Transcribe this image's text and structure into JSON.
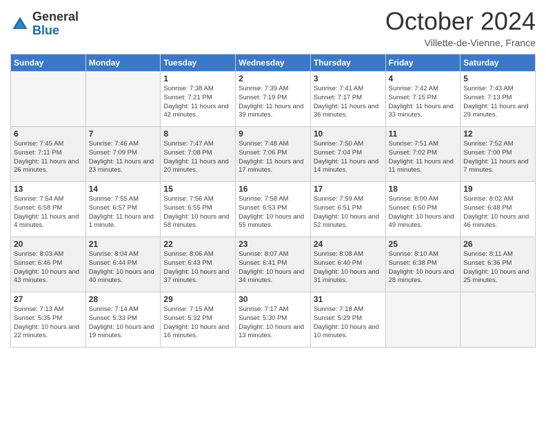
{
  "logo": {
    "general": "General",
    "blue": "Blue"
  },
  "title": "October 2024",
  "location": "Villette-de-Vienne, France",
  "days_of_week": [
    "Sunday",
    "Monday",
    "Tuesday",
    "Wednesday",
    "Thursday",
    "Friday",
    "Saturday"
  ],
  "weeks": [
    [
      {
        "day": "",
        "info": ""
      },
      {
        "day": "",
        "info": ""
      },
      {
        "day": "1",
        "info": "Sunrise: 7:38 AM\nSunset: 7:21 PM\nDaylight: 11 hours and 42 minutes."
      },
      {
        "day": "2",
        "info": "Sunrise: 7:39 AM\nSunset: 7:19 PM\nDaylight: 11 hours and 39 minutes."
      },
      {
        "day": "3",
        "info": "Sunrise: 7:41 AM\nSunset: 7:17 PM\nDaylight: 11 hours and 36 minutes."
      },
      {
        "day": "4",
        "info": "Sunrise: 7:42 AM\nSunset: 7:15 PM\nDaylight: 11 hours and 33 minutes."
      },
      {
        "day": "5",
        "info": "Sunrise: 7:43 AM\nSunset: 7:13 PM\nDaylight: 11 hours and 29 minutes."
      }
    ],
    [
      {
        "day": "6",
        "info": "Sunrise: 7:45 AM\nSunset: 7:11 PM\nDaylight: 11 hours and 26 minutes."
      },
      {
        "day": "7",
        "info": "Sunrise: 7:46 AM\nSunset: 7:09 PM\nDaylight: 11 hours and 23 minutes."
      },
      {
        "day": "8",
        "info": "Sunrise: 7:47 AM\nSunset: 7:08 PM\nDaylight: 11 hours and 20 minutes."
      },
      {
        "day": "9",
        "info": "Sunrise: 7:48 AM\nSunset: 7:06 PM\nDaylight: 11 hours and 17 minutes."
      },
      {
        "day": "10",
        "info": "Sunrise: 7:50 AM\nSunset: 7:04 PM\nDaylight: 11 hours and 14 minutes."
      },
      {
        "day": "11",
        "info": "Sunrise: 7:51 AM\nSunset: 7:02 PM\nDaylight: 11 hours and 11 minutes."
      },
      {
        "day": "12",
        "info": "Sunrise: 7:52 AM\nSunset: 7:00 PM\nDaylight: 11 hours and 7 minutes."
      }
    ],
    [
      {
        "day": "13",
        "info": "Sunrise: 7:54 AM\nSunset: 6:58 PM\nDaylight: 11 hours and 4 minutes."
      },
      {
        "day": "14",
        "info": "Sunrise: 7:55 AM\nSunset: 6:57 PM\nDaylight: 11 hours and 1 minute."
      },
      {
        "day": "15",
        "info": "Sunrise: 7:56 AM\nSunset: 6:55 PM\nDaylight: 10 hours and 58 minutes."
      },
      {
        "day": "16",
        "info": "Sunrise: 7:58 AM\nSunset: 6:53 PM\nDaylight: 10 hours and 55 minutes."
      },
      {
        "day": "17",
        "info": "Sunrise: 7:59 AM\nSunset: 6:51 PM\nDaylight: 10 hours and 52 minutes."
      },
      {
        "day": "18",
        "info": "Sunrise: 8:00 AM\nSunset: 6:50 PM\nDaylight: 10 hours and 49 minutes."
      },
      {
        "day": "19",
        "info": "Sunrise: 8:02 AM\nSunset: 6:48 PM\nDaylight: 10 hours and 46 minutes."
      }
    ],
    [
      {
        "day": "20",
        "info": "Sunrise: 8:03 AM\nSunset: 6:46 PM\nDaylight: 10 hours and 43 minutes."
      },
      {
        "day": "21",
        "info": "Sunrise: 8:04 AM\nSunset: 6:44 PM\nDaylight: 10 hours and 40 minutes."
      },
      {
        "day": "22",
        "info": "Sunrise: 8:06 AM\nSunset: 6:43 PM\nDaylight: 10 hours and 37 minutes."
      },
      {
        "day": "23",
        "info": "Sunrise: 8:07 AM\nSunset: 6:41 PM\nDaylight: 10 hours and 34 minutes."
      },
      {
        "day": "24",
        "info": "Sunrise: 8:08 AM\nSunset: 6:40 PM\nDaylight: 10 hours and 31 minutes."
      },
      {
        "day": "25",
        "info": "Sunrise: 8:10 AM\nSunset: 6:38 PM\nDaylight: 10 hours and 28 minutes."
      },
      {
        "day": "26",
        "info": "Sunrise: 8:11 AM\nSunset: 6:36 PM\nDaylight: 10 hours and 25 minutes."
      }
    ],
    [
      {
        "day": "27",
        "info": "Sunrise: 7:13 AM\nSunset: 5:35 PM\nDaylight: 10 hours and 22 minutes."
      },
      {
        "day": "28",
        "info": "Sunrise: 7:14 AM\nSunset: 5:33 PM\nDaylight: 10 hours and 19 minutes."
      },
      {
        "day": "29",
        "info": "Sunrise: 7:15 AM\nSunset: 5:32 PM\nDaylight: 10 hours and 16 minutes."
      },
      {
        "day": "30",
        "info": "Sunrise: 7:17 AM\nSunset: 5:30 PM\nDaylight: 10 hours and 13 minutes."
      },
      {
        "day": "31",
        "info": "Sunrise: 7:18 AM\nSunset: 5:29 PM\nDaylight: 10 hours and 10 minutes."
      },
      {
        "day": "",
        "info": ""
      },
      {
        "day": "",
        "info": ""
      }
    ]
  ]
}
